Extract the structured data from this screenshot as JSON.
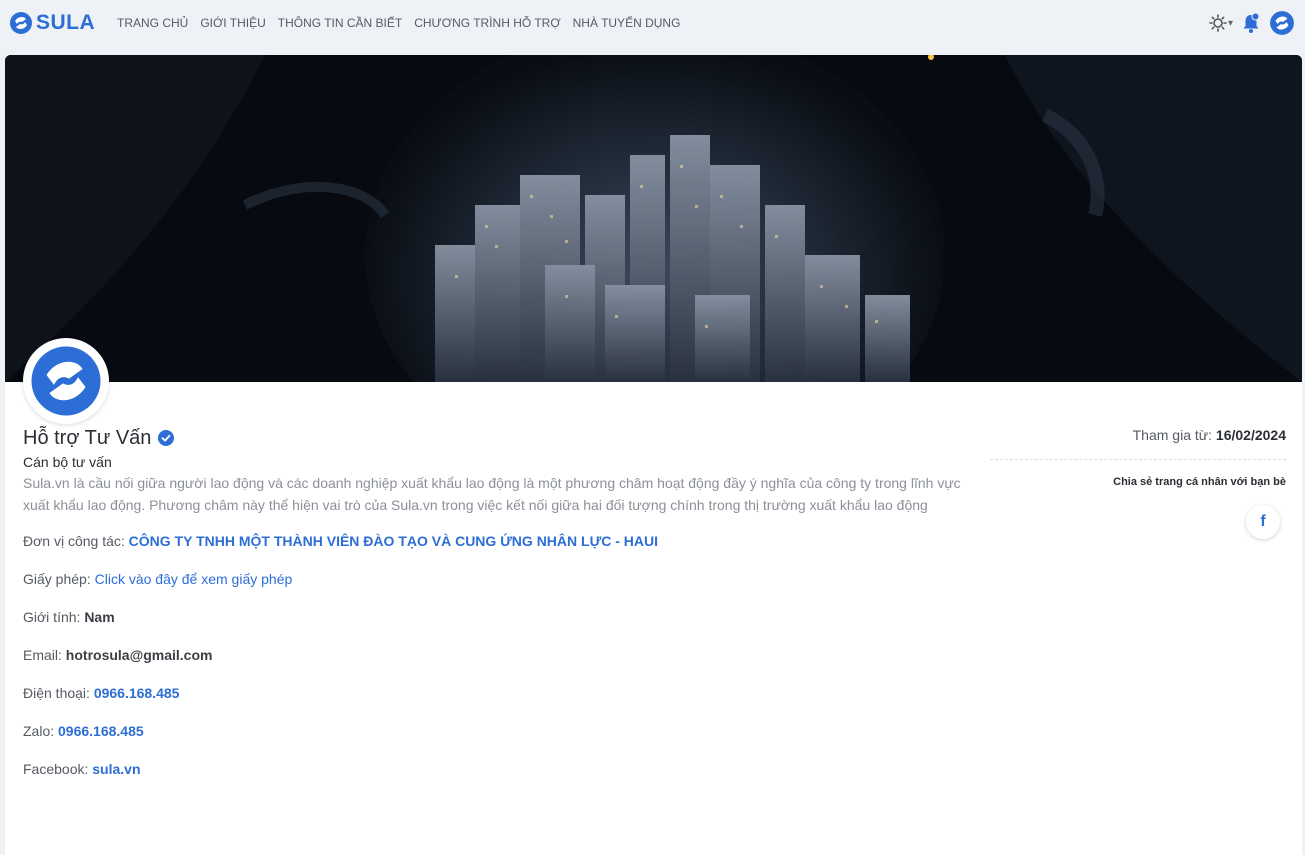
{
  "brand": {
    "name": "SULA",
    "color": "#2c6ed5"
  },
  "nav": [
    {
      "label": "TRANG CHỦ"
    },
    {
      "label": "GIỚI THIỆU"
    },
    {
      "label": "THÔNG TIN CẦN BIẾT"
    },
    {
      "label": "CHƯƠNG TRÌNH HỖ TRỢ"
    },
    {
      "label": "NHÀ TUYỂN DỤNG"
    }
  ],
  "tools": {
    "theme_icon": "sun-icon",
    "notification_icon": "bell-icon",
    "avatar_icon": "sula-logo-icon"
  },
  "profile": {
    "name": "Hỗ trợ Tư Vấn",
    "role": "Cán bộ tư vấn",
    "bio": "Sula.vn là cầu nối giữa người lao động và các doanh nghiệp xuất khẩu lao động là một phương châm hoạt động đầy ý nghĩa của công ty trong lĩnh vực xuất khẩu lao động. Phương châm này thể hiện vai trò của Sula.vn trong việc kết nối giữa hai đối tượng chính trong thị trường xuất khẩu lao động",
    "company_label": "Đơn vị công tác:",
    "company_value": "CÔNG TY TNHH MỘT THÀNH VIÊN ĐÀO TẠO VÀ CUNG ỨNG NHÂN LỰC - HAUI",
    "license_label": "Giấy phép:",
    "license_link": "Click vào đây để xem giấy phép",
    "gender_label": "Giới tính:",
    "gender_value": "Nam",
    "email_label": "Email:",
    "email_value": "hotrosula@gmail.com",
    "phone_label": "Điện thoại:",
    "phone_value": "0966.168.485",
    "zalo_label": "Zalo:",
    "zalo_value": "0966.168.485",
    "facebook_label": "Facebook:",
    "facebook_value": "sula.vn"
  },
  "side": {
    "joined_label": "Tham gia từ:",
    "joined_value": "16/02/2024",
    "share_label": "Chia sẻ trang cá nhân với bạn bè",
    "facebook_glyph": "f"
  }
}
